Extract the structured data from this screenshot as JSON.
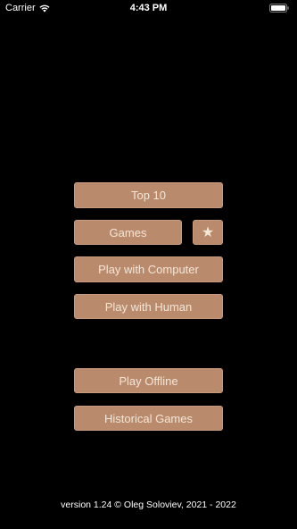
{
  "status_bar": {
    "carrier": "Carrier",
    "time": "4:43 PM",
    "wifi_icon": "wifi-icon",
    "battery_icon": "battery-icon"
  },
  "menu": {
    "top10": "Top 10",
    "games": "Games",
    "favorites_icon": "★",
    "play_computer": "Play with Computer",
    "play_human": "Play with Human",
    "play_offline": "Play Offline",
    "historical_games": "Historical Games"
  },
  "footer": {
    "version_text": "version 1.24 © Oleg Soloviev, 2021 - 2022"
  },
  "colors": {
    "background": "#000000",
    "button": "#b98a6c",
    "button_text": "#f4e7d8"
  }
}
